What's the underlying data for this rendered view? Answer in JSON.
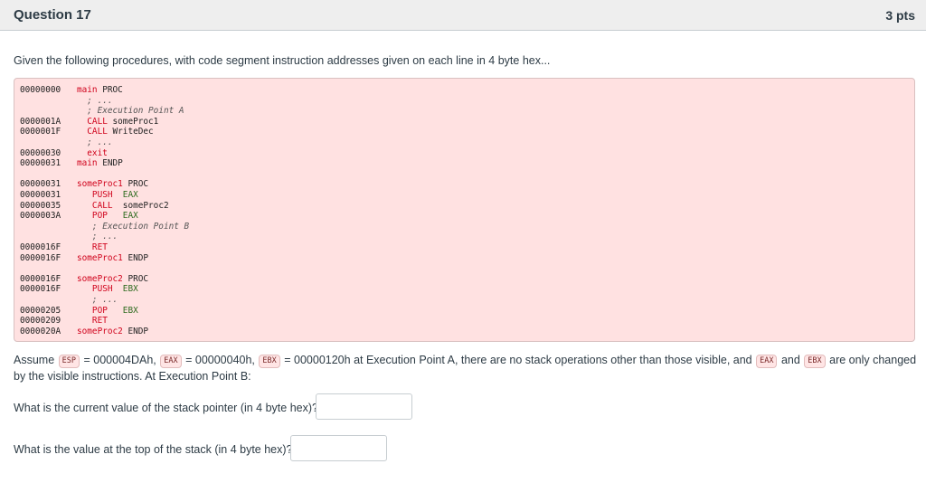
{
  "question": {
    "title": "Question 17",
    "points": "3 pts"
  },
  "intro": "Given the following procedures, with code segment instruction addresses given on each line in 4 byte hex...",
  "code_lines": [
    {
      "addr": "00000000",
      "tokens": [
        {
          "t": "main",
          "c": "red"
        },
        {
          "t": " PROC",
          "c": "dark"
        }
      ]
    },
    {
      "addr": "",
      "tokens": [
        {
          "t": "  ; ...",
          "c": "comment"
        }
      ]
    },
    {
      "addr": "",
      "tokens": [
        {
          "t": "  ; Execution Point A",
          "c": "comment"
        }
      ]
    },
    {
      "addr": "0000001A",
      "tokens": [
        {
          "t": "  CALL",
          "c": "red"
        },
        {
          "t": " someProc1",
          "c": "dark"
        }
      ]
    },
    {
      "addr": "0000001F",
      "tokens": [
        {
          "t": "  CALL",
          "c": "red"
        },
        {
          "t": " WriteDec",
          "c": "dark"
        }
      ]
    },
    {
      "addr": "",
      "tokens": [
        {
          "t": "  ; ...",
          "c": "comment"
        }
      ]
    },
    {
      "addr": "00000030",
      "tokens": [
        {
          "t": "  exit",
          "c": "red"
        }
      ]
    },
    {
      "addr": "00000031",
      "tokens": [
        {
          "t": "main",
          "c": "red"
        },
        {
          "t": " ENDP",
          "c": "dark"
        }
      ]
    },
    {
      "addr": "",
      "tokens": []
    },
    {
      "addr": "00000031",
      "tokens": [
        {
          "t": "someProc1",
          "c": "red"
        },
        {
          "t": " PROC",
          "c": "dark"
        }
      ]
    },
    {
      "addr": "00000031",
      "tokens": [
        {
          "t": "   PUSH",
          "c": "red"
        },
        {
          "t": "  EAX",
          "c": "green"
        }
      ]
    },
    {
      "addr": "00000035",
      "tokens": [
        {
          "t": "   CALL",
          "c": "red"
        },
        {
          "t": "  someProc2",
          "c": "dark"
        }
      ]
    },
    {
      "addr": "0000003A",
      "tokens": [
        {
          "t": "   POP",
          "c": "red"
        },
        {
          "t": "   EAX",
          "c": "green"
        }
      ]
    },
    {
      "addr": "",
      "tokens": [
        {
          "t": "   ; Execution Point B",
          "c": "comment"
        }
      ]
    },
    {
      "addr": "",
      "tokens": [
        {
          "t": "   ; ...",
          "c": "comment"
        }
      ]
    },
    {
      "addr": "0000016F",
      "tokens": [
        {
          "t": "   RET",
          "c": "red"
        }
      ]
    },
    {
      "addr": "0000016F",
      "tokens": [
        {
          "t": "someProc1",
          "c": "red"
        },
        {
          "t": " ENDP",
          "c": "dark"
        }
      ]
    },
    {
      "addr": "",
      "tokens": []
    },
    {
      "addr": "0000016F",
      "tokens": [
        {
          "t": "someProc2",
          "c": "red"
        },
        {
          "t": " PROC",
          "c": "dark"
        }
      ]
    },
    {
      "addr": "0000016F",
      "tokens": [
        {
          "t": "   PUSH",
          "c": "red"
        },
        {
          "t": "  EBX",
          "c": "green"
        }
      ]
    },
    {
      "addr": "",
      "tokens": [
        {
          "t": "   ; ...",
          "c": "comment"
        }
      ]
    },
    {
      "addr": "00000205",
      "tokens": [
        {
          "t": "   POP",
          "c": "red"
        },
        {
          "t": "   EBX",
          "c": "green"
        }
      ]
    },
    {
      "addr": "00000209",
      "tokens": [
        {
          "t": "   RET",
          "c": "red"
        }
      ]
    },
    {
      "addr": "0000020A",
      "tokens": [
        {
          "t": "someProc2",
          "c": "red"
        },
        {
          "t": " ENDP",
          "c": "dark"
        }
      ]
    }
  ],
  "assumption": {
    "p1": "Assume",
    "reg_esp": "ESP",
    "p2": "= 000004DAh,",
    "reg_eax": "EAX",
    "p3": "= 00000040h,",
    "reg_ebx": "EBX",
    "p4": "= 00000120h at Execution Point A, there are no stack operations other than those visible, and",
    "reg_eax2": "EAX",
    "p5": "and",
    "reg_ebx2": "EBX",
    "p6": "are only changed by the visible instructions. At Execution Point B:"
  },
  "questions": [
    {
      "label": "What is the current value of the stack pointer (in 4 byte hex)?",
      "value": ""
    },
    {
      "label": "What is the value at the top of the stack (in 4 byte hex)?",
      "value": ""
    }
  ],
  "colors": {
    "code_bg": "#ffe1e1",
    "keyword_red": "#d0021b",
    "register_green": "#2e6b1f"
  }
}
